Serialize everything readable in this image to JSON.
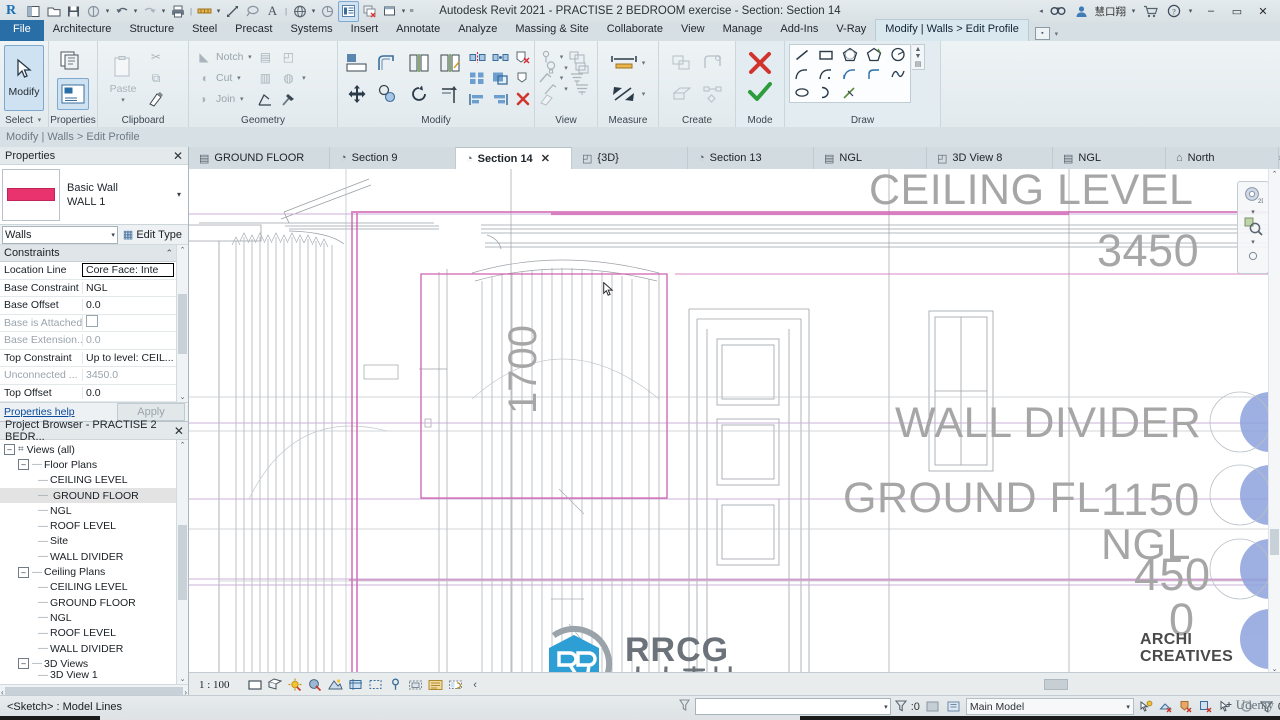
{
  "titlebar": {
    "app_title": "Autodesk Revit 2021 - PRACTISE 2 BEDROOM exercise - Section: Section 14",
    "user_name": "慧口翔",
    "quick_access": [
      {
        "name": "revit-logo",
        "glyph": "R"
      },
      {
        "name": "new-project-icon",
        "glyph": "▤"
      },
      {
        "name": "open-project-icon",
        "glyph": "▷"
      },
      {
        "name": "save-icon",
        "glyph": "▤"
      },
      {
        "name": "save-as-icon",
        "glyph": "◈"
      },
      {
        "name": "undo-icon",
        "glyph": "↶"
      },
      {
        "name": "redo-icon",
        "glyph": "↷"
      },
      {
        "name": "print-icon",
        "glyph": "⎙"
      },
      {
        "name": "measure-icon",
        "glyph": "⇔"
      },
      {
        "name": "aligned-dimension-icon",
        "glyph": "⟋"
      },
      {
        "name": "tag-icon",
        "glyph": "◌"
      },
      {
        "name": "text-icon",
        "glyph": "A"
      },
      {
        "name": "default-3d-view-icon",
        "glyph": "◍"
      },
      {
        "name": "section-icon",
        "glyph": "◑"
      },
      {
        "name": "thin-lines-icon",
        "glyph": "▤"
      },
      {
        "name": "close-hidden-windows-icon",
        "glyph": "▣"
      },
      {
        "name": "switch-windows-icon",
        "glyph": "▦"
      },
      {
        "name": "customize-qat-icon",
        "glyph": "▾"
      }
    ],
    "window_buttons": [
      "–",
      "▭",
      "✕"
    ]
  },
  "ribbon_tabs": {
    "items": [
      {
        "label": "File",
        "type": "file"
      },
      {
        "label": "Architecture"
      },
      {
        "label": "Structure"
      },
      {
        "label": "Steel"
      },
      {
        "label": "Precast"
      },
      {
        "label": "Systems"
      },
      {
        "label": "Insert"
      },
      {
        "label": "Annotate"
      },
      {
        "label": "Analyze"
      },
      {
        "label": "Massing & Site"
      },
      {
        "label": "Collaborate"
      },
      {
        "label": "View"
      },
      {
        "label": "Manage"
      },
      {
        "label": "Add-Ins"
      },
      {
        "label": "V-Ray"
      },
      {
        "label": "Modify | Walls > Edit Profile",
        "type": "contextual"
      }
    ]
  },
  "ribbon": {
    "panels": [
      {
        "title": "Select"
      },
      {
        "title": "Properties"
      },
      {
        "title": "Clipboard"
      },
      {
        "title": "Geometry"
      },
      {
        "title": "Modify"
      },
      {
        "title": "View"
      },
      {
        "title": "Measure"
      },
      {
        "title": "Create"
      },
      {
        "title": "Mode"
      },
      {
        "title": "Draw"
      }
    ],
    "modify_button": "Modify",
    "paste_button": "Paste",
    "geometry_labels": [
      "Notch",
      "Cut",
      "Join"
    ]
  },
  "options_bar": {
    "text": "Modify | Walls > Edit Profile"
  },
  "properties": {
    "panel_title": "Properties",
    "family": "Basic Wall",
    "type": "WALL 1",
    "category": "Walls",
    "edit_type_label": "Edit Type",
    "group_label": "Constraints",
    "rows": [
      {
        "key": "Location Line",
        "value": "Core Face: Inte",
        "focus": true,
        "disabled": false
      },
      {
        "key": "Base Constraint",
        "value": "NGL",
        "disabled": false
      },
      {
        "key": "Base Offset",
        "value": "0.0",
        "disabled": false
      },
      {
        "key": "Base is Attached",
        "value": "",
        "checkbox": true,
        "disabled": true
      },
      {
        "key": "Base Extension...",
        "value": "0.0",
        "disabled": true
      },
      {
        "key": "Top Constraint",
        "value": "Up to level: CEIL...",
        "disabled": false
      },
      {
        "key": "Unconnected ...",
        "value": "3450.0",
        "disabled": true
      },
      {
        "key": "Top Offset",
        "value": "0.0",
        "disabled": false
      }
    ],
    "help_link": "Properties help",
    "apply_button": "Apply"
  },
  "project_browser": {
    "panel_title": "Project Browser - PRACTISE 2 BEDR...",
    "nodes": [
      {
        "label": "Views (all)",
        "depth": 0,
        "expandable": true,
        "expanded": true,
        "icon": "views-icon"
      },
      {
        "label": "Floor Plans",
        "depth": 1,
        "expandable": true,
        "expanded": true
      },
      {
        "label": "CEILING LEVEL",
        "depth": 2
      },
      {
        "label": "GROUND FLOOR",
        "depth": 2,
        "selected": true
      },
      {
        "label": "NGL",
        "depth": 2
      },
      {
        "label": "ROOF LEVEL",
        "depth": 2
      },
      {
        "label": "Site",
        "depth": 2
      },
      {
        "label": "WALL DIVIDER",
        "depth": 2
      },
      {
        "label": "Ceiling Plans",
        "depth": 1,
        "expandable": true,
        "expanded": true
      },
      {
        "label": "CEILING LEVEL",
        "depth": 2
      },
      {
        "label": "GROUND FLOOR",
        "depth": 2
      },
      {
        "label": "NGL",
        "depth": 2
      },
      {
        "label": "ROOF LEVEL",
        "depth": 2
      },
      {
        "label": "WALL DIVIDER",
        "depth": 2
      },
      {
        "label": "3D Views",
        "depth": 1,
        "expandable": true,
        "expanded": true
      },
      {
        "label": "3D View 1",
        "depth": 2
      }
    ]
  },
  "view_tabs": [
    {
      "label": "GROUND FLOOR",
      "icon": "floor-plan-icon",
      "active": false,
      "closable": false
    },
    {
      "label": "Section 9",
      "icon": "section-icon",
      "active": false,
      "closable": false
    },
    {
      "label": "Section 14",
      "icon": "section-icon",
      "active": true,
      "closable": true
    },
    {
      "label": "{3D}",
      "icon": "three-d-icon",
      "active": false,
      "closable": false
    },
    {
      "label": "Section 13",
      "icon": "section-icon",
      "active": false,
      "closable": false
    },
    {
      "label": "NGL",
      "icon": "floor-plan-icon",
      "active": false,
      "closable": false
    },
    {
      "label": "3D View 8",
      "icon": "three-d-icon",
      "active": false,
      "closable": false
    },
    {
      "label": "NGL",
      "icon": "floor-plan-icon",
      "active": false,
      "closable": false
    },
    {
      "label": "North",
      "icon": "elevation-icon",
      "active": false,
      "closable": false
    }
  ],
  "canvas": {
    "levels": [
      {
        "name": "CEILING LEVEL",
        "elevation": "3450"
      },
      {
        "name": "WALL DIVIDER",
        "elevation": "1150"
      },
      {
        "name": "GROUND FL",
        "elevation": ""
      },
      {
        "name": "NGL",
        "elevation": "450"
      },
      {
        "name": "",
        "elevation": "0"
      }
    ],
    "dimension": "1700",
    "grid_color": "#d8c0d8",
    "sketch_color": "#d060b0",
    "model_line_color": "#9aa0a6",
    "level_text_color": "#a6a6a6"
  },
  "watermarks": {
    "rrcg_latin": "RRCG",
    "rrcg_cjk": "人人素材",
    "archi_top": "ARCHI",
    "archi_bottom": "CREATIVES",
    "udemy": "Udemy"
  },
  "view_control_bar": {
    "scale": "1 : 100",
    "icons": [
      {
        "name": "detail-level-coarse-icon",
        "glyph": "▭"
      },
      {
        "name": "visual-style-icon",
        "glyph": "⬠"
      },
      {
        "name": "sun-path-icon",
        "glyph": "☀"
      },
      {
        "name": "shadows-icon",
        "glyph": "◐"
      },
      {
        "name": "rendering-dialog-icon",
        "glyph": "⬡"
      },
      {
        "name": "crop-view-icon",
        "glyph": "⬛"
      },
      {
        "name": "show-crop-region-icon",
        "glyph": "⬚"
      },
      {
        "name": "unlock-3d-view-icon",
        "glyph": "⚲"
      },
      {
        "name": "temporary-hide-isolate-icon",
        "glyph": "▣"
      },
      {
        "name": "reveal-hidden-elements-icon",
        "glyph": "▨"
      },
      {
        "name": "temporary-view-properties-icon",
        "glyph": "▥"
      },
      {
        "name": "hide-analytical-model-icon",
        "glyph": "‹"
      }
    ]
  },
  "status_bar": {
    "message": "<Sketch> : Model Lines",
    "filter_value": "",
    "selection_count": ":0",
    "workset": "Main Model",
    "right_icons": [
      {
        "name": "select-links-icon",
        "glyph": "⚴"
      },
      {
        "name": "select-underlay-elements-icon",
        "glyph": "⚵"
      },
      {
        "name": "select-pinned-elements-icon",
        "glyph": "⚶"
      },
      {
        "name": "select-elements-by-face-icon",
        "glyph": "⚷"
      },
      {
        "name": "drag-elements-on-selection-icon",
        "glyph": "⚸"
      },
      {
        "name": "selection-toggle-icon",
        "glyph": "◌"
      },
      {
        "name": "filter-icon",
        "glyph": "▽"
      }
    ],
    "filter_count": "0"
  }
}
